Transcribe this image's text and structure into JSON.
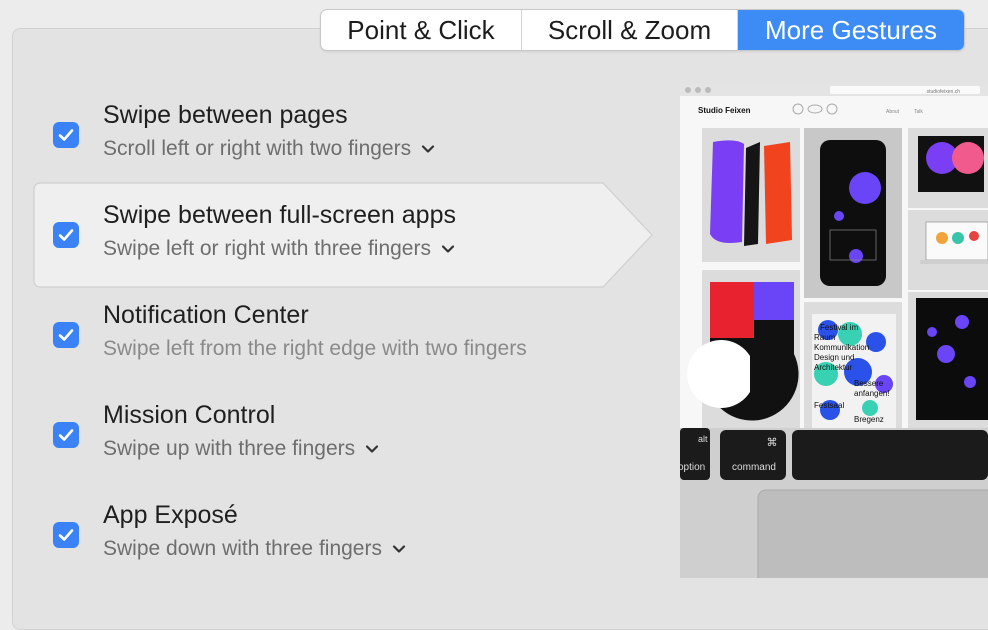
{
  "tabs": [
    {
      "label": "Point & Click",
      "selected": false
    },
    {
      "label": "Scroll & Zoom",
      "selected": false
    },
    {
      "label": "More Gestures",
      "selected": true
    }
  ],
  "gestures": [
    {
      "title": "Swipe between pages",
      "subtitle": "Scroll left or right with two fingers",
      "checked": true,
      "has_menu": true
    },
    {
      "title": "Swipe between full-screen apps",
      "subtitle": "Swipe left or right with three fingers",
      "checked": true,
      "has_menu": true,
      "selected": true
    },
    {
      "title": "Notification Center",
      "subtitle": "Swipe left from the right edge with two fingers",
      "checked": true,
      "has_menu": false
    },
    {
      "title": "Mission Control",
      "subtitle": "Swipe up with three fingers",
      "checked": true,
      "has_menu": true
    },
    {
      "title": "App Exposé",
      "subtitle": "Swipe down with three fingers",
      "checked": true,
      "has_menu": true
    }
  ],
  "preview": {
    "site_url": "studiofeixen.ch",
    "site_name": "Studio Feixen",
    "nav": [
      "About",
      "Talk"
    ],
    "keys": {
      "alt": "alt",
      "option": "option",
      "command_symbol": "⌘",
      "command": "command"
    },
    "poster_text": [
      "Festival im",
      "Raum",
      "Kommunikation",
      "Design und",
      "Architektur",
      "Bessere",
      "anfangen!",
      "Festsaal",
      "Bregenz"
    ]
  },
  "colors": {
    "accent": "#3d8cf5",
    "checkbox": "#3b82f6",
    "panel_bg": "#e3e3e3"
  }
}
